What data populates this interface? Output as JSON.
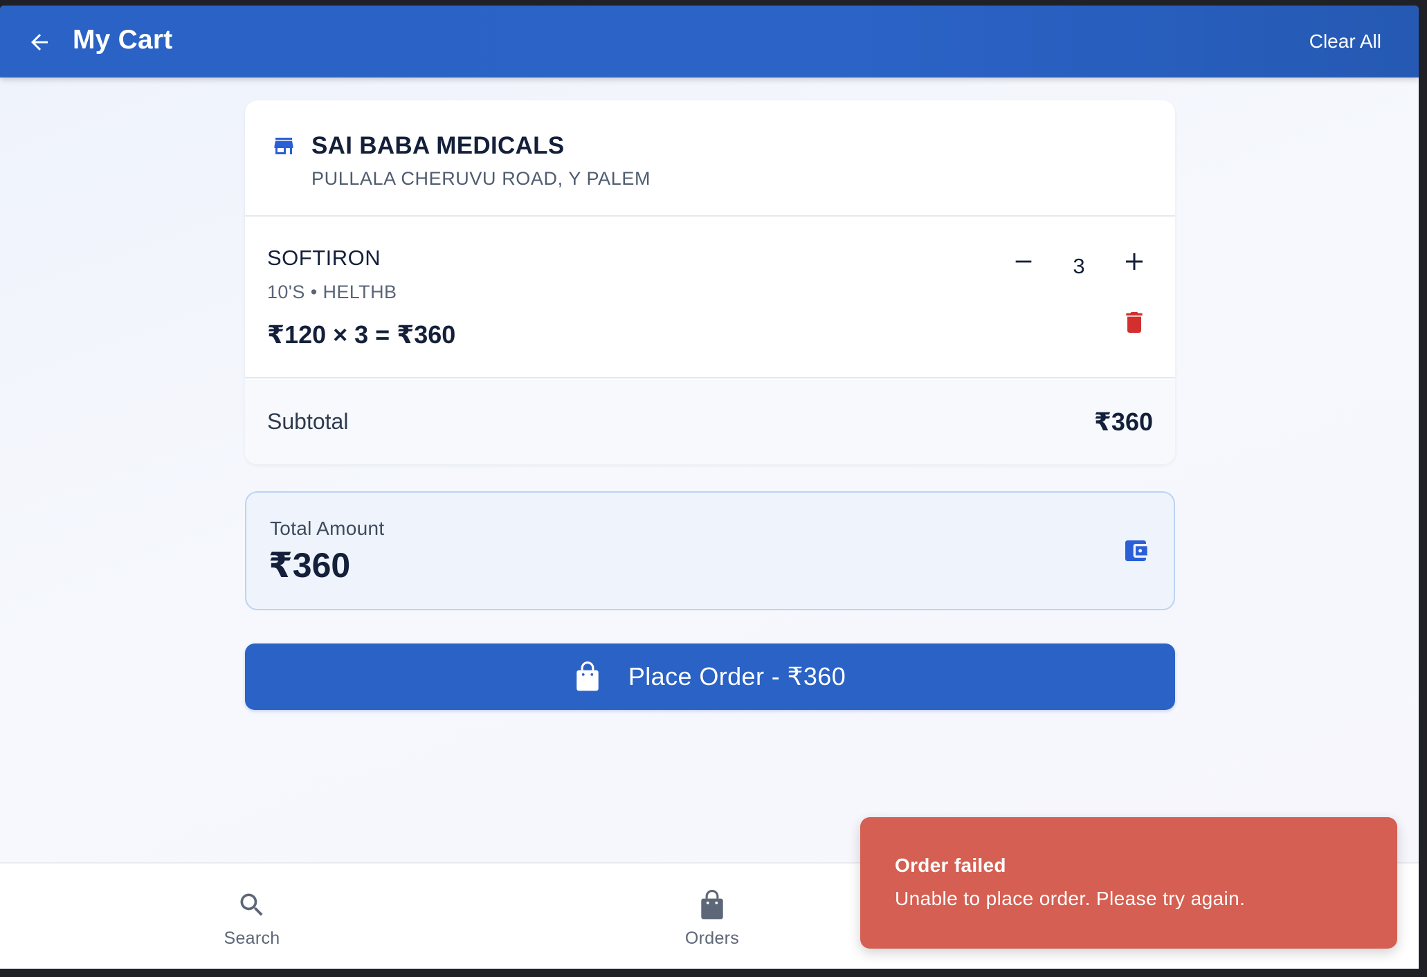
{
  "app_bar": {
    "title": "My Cart",
    "clear_all_label": "Clear All",
    "back_icon": "arrow-left-icon"
  },
  "store": {
    "icon": "store-icon",
    "name": "SAI BABA MEDICALS",
    "address": "PULLALA CHERUVU ROAD, Y PALEM"
  },
  "cart_items": [
    {
      "name": "SOFTIRON",
      "meta": "10'S • HELTHB",
      "price_line": "₹120 × 3 = ₹360",
      "quantity": "3"
    }
  ],
  "subtotal": {
    "label": "Subtotal",
    "value": "₹360"
  },
  "total": {
    "label": "Total Amount",
    "value": "₹360",
    "icon": "wallet-icon"
  },
  "place_order": {
    "label": "Place Order - ₹360",
    "icon": "shopping-bag-icon"
  },
  "bottom_nav": {
    "items": [
      {
        "label": "Search",
        "icon": "search-icon"
      },
      {
        "label": "Orders",
        "icon": "shopping-bag-icon"
      }
    ]
  },
  "toast": {
    "title": "Order failed",
    "message": "Unable to place order. Please try again."
  },
  "colors": {
    "primary": "#2a62c6",
    "danger": "#d32f2f",
    "toast_bg": "#d55f52",
    "total_bg": "#eff4fc"
  }
}
